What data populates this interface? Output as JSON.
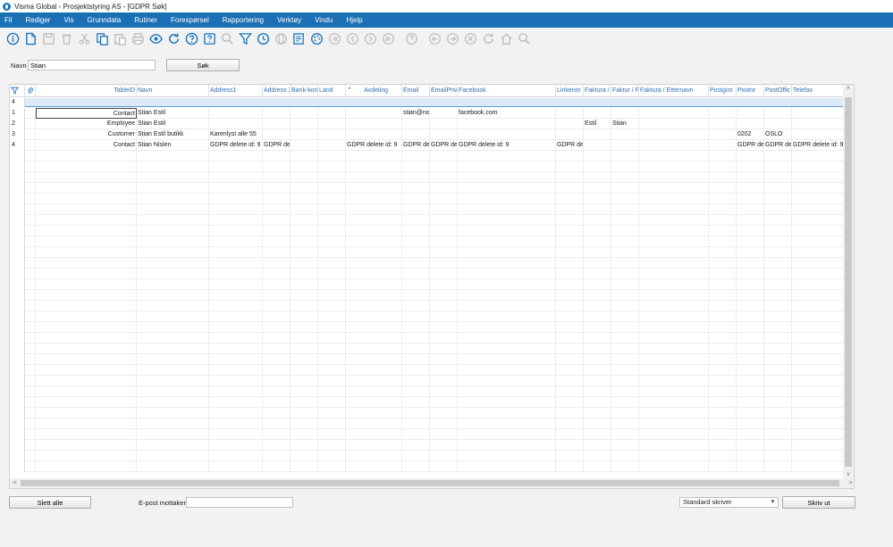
{
  "window": {
    "title": "Visma Global - Prosjektstyring AS - [GDPR Søk]"
  },
  "menu": [
    "Fil",
    "Rediger",
    "Vis",
    "Grunndata",
    "Rutiner",
    "Forespørsel",
    "Rapportering",
    "Verktøy",
    "Vindu",
    "Hjelp"
  ],
  "search": {
    "label": "Navn",
    "value": "Stian",
    "button": "Søk"
  },
  "grid": {
    "row_count": "4",
    "columns": [
      "TableID",
      "Navn",
      "Address1",
      "Address 2",
      "Bank-kont",
      "Land",
      "Avdeling",
      "Email",
      "EmailPriva",
      "Facebook",
      "LinkenIn",
      "Faktura /",
      "Faktur / F",
      "Faktura / Etternavn",
      "Postgiro",
      "Postnr",
      "PostOffic",
      "Telefax"
    ],
    "rows": [
      {
        "num": "1",
        "cells": [
          "Contact",
          "Stian Estil",
          "",
          "",
          "",
          "",
          "",
          "stian@no",
          "",
          "facebook.com",
          "",
          "",
          "",
          "",
          "",
          "",
          "",
          ""
        ]
      },
      {
        "num": "2",
        "cells": [
          "Employee",
          "Stian Estil",
          "",
          "",
          "",
          "",
          "",
          "",
          "",
          "",
          "",
          "Estil",
          "Stian",
          "",
          "",
          "",
          "",
          ""
        ]
      },
      {
        "num": "3",
        "cells": [
          "Customer",
          "Stian Estil butikk",
          "Karenlyst alle 55",
          "",
          "",
          "",
          "",
          "",
          "",
          "",
          "",
          "",
          "",
          "",
          "",
          "0202",
          "OSLO",
          ""
        ]
      },
      {
        "num": "4",
        "cells": [
          "Contact",
          "Stian Nislen",
          "GDPR delete id: 9",
          "GDPR del",
          "",
          "",
          "GDPR delete id: 9",
          "GDPR del",
          "GDPR del",
          "GDPR delete id: 9",
          "GDPR del",
          "",
          "",
          "",
          "",
          "GDPR del",
          "GDPR del",
          "GDPR delete id: 9"
        ]
      }
    ]
  },
  "footer": {
    "delete_all": "Slett alle",
    "email_label": "E-post mottaker",
    "email_value": "",
    "printer_value": "Standard skriver",
    "print_button": "Skriv ut"
  },
  "colors": {
    "menubar": "#1b6fb5",
    "icon": "#1b75bb",
    "icon_disabled": "#b8b8b8",
    "header_text": "#2e6eb0"
  }
}
